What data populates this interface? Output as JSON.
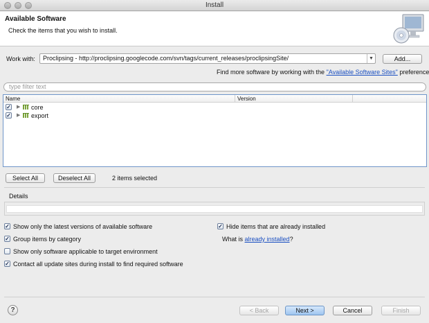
{
  "window": {
    "title": "Install"
  },
  "banner": {
    "title": "Available Software",
    "subtitle": "Check the items that you wish to install."
  },
  "work_with": {
    "label": "Work with:",
    "value": "Proclipsing - http://proclipsing.googlecode.com/svn/tags/current_releases/proclipsingSite/",
    "add_label": "Add..."
  },
  "more_software": {
    "prefix": "Find more software by working with the ",
    "link": "\"Available Software Sites\"",
    "suffix": " preferences."
  },
  "filter": {
    "placeholder": "type filter text"
  },
  "tree": {
    "columns": [
      "Name",
      "Version"
    ],
    "rows": [
      {
        "label": "core",
        "checked": true,
        "version": ""
      },
      {
        "label": "export",
        "checked": true,
        "version": ""
      }
    ]
  },
  "selection": {
    "select_all": "Select All",
    "deselect_all": "Deselect All",
    "status": "2 items selected"
  },
  "details": {
    "label": "Details",
    "text": ""
  },
  "options": {
    "latest_versions": {
      "label": "Show only the latest versions of available software",
      "checked": true
    },
    "group_by_category": {
      "label": "Group items by category",
      "checked": true
    },
    "target_env": {
      "label": "Show only software applicable to target environment",
      "checked": false
    },
    "contact_sites": {
      "label": "Contact all update sites during install to find required software",
      "checked": true
    },
    "hide_installed": {
      "label": "Hide items that are already installed",
      "checked": true
    },
    "what_is_prefix": "What is ",
    "what_is_link": "already installed",
    "what_is_suffix": "?"
  },
  "footer": {
    "help": "?",
    "back": "< Back",
    "next": "Next >",
    "cancel": "Cancel",
    "finish": "Finish"
  },
  "colors": {
    "link": "#1a4fc1",
    "selection_border": "#6f95c9",
    "default_button": "#9ec5ef"
  }
}
